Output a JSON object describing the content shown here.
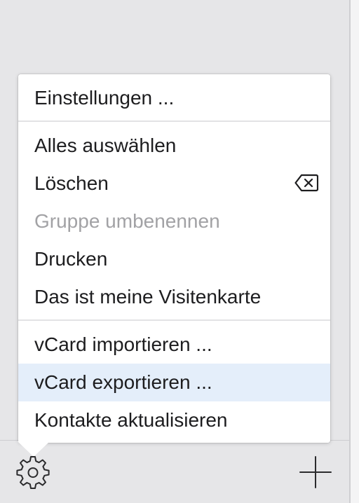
{
  "menu": {
    "items": [
      {
        "label": "Einstellungen ...",
        "enabled": true
      },
      {
        "label": "Alles auswählen",
        "enabled": true
      },
      {
        "label": "Löschen",
        "enabled": true,
        "shortcut_icon": "delete-backward-icon"
      },
      {
        "label": "Gruppe umbenennen",
        "enabled": false
      },
      {
        "label": "Drucken",
        "enabled": true
      },
      {
        "label": "Das ist meine Visitenkarte",
        "enabled": true
      },
      {
        "label": "vCard importieren ...",
        "enabled": true
      },
      {
        "label": "vCard exportieren ...",
        "enabled": true,
        "highlighted": true
      },
      {
        "label": "Kontakte aktualisieren",
        "enabled": true
      }
    ]
  },
  "toolbar": {
    "left_icon": "gear-icon",
    "right_icon": "plus-icon"
  },
  "colors": {
    "menu_text": "#1d1d1f",
    "disabled_text": "#a2a2a5",
    "highlight_bg": "#e4eefa",
    "background": "#e6e6e8"
  }
}
